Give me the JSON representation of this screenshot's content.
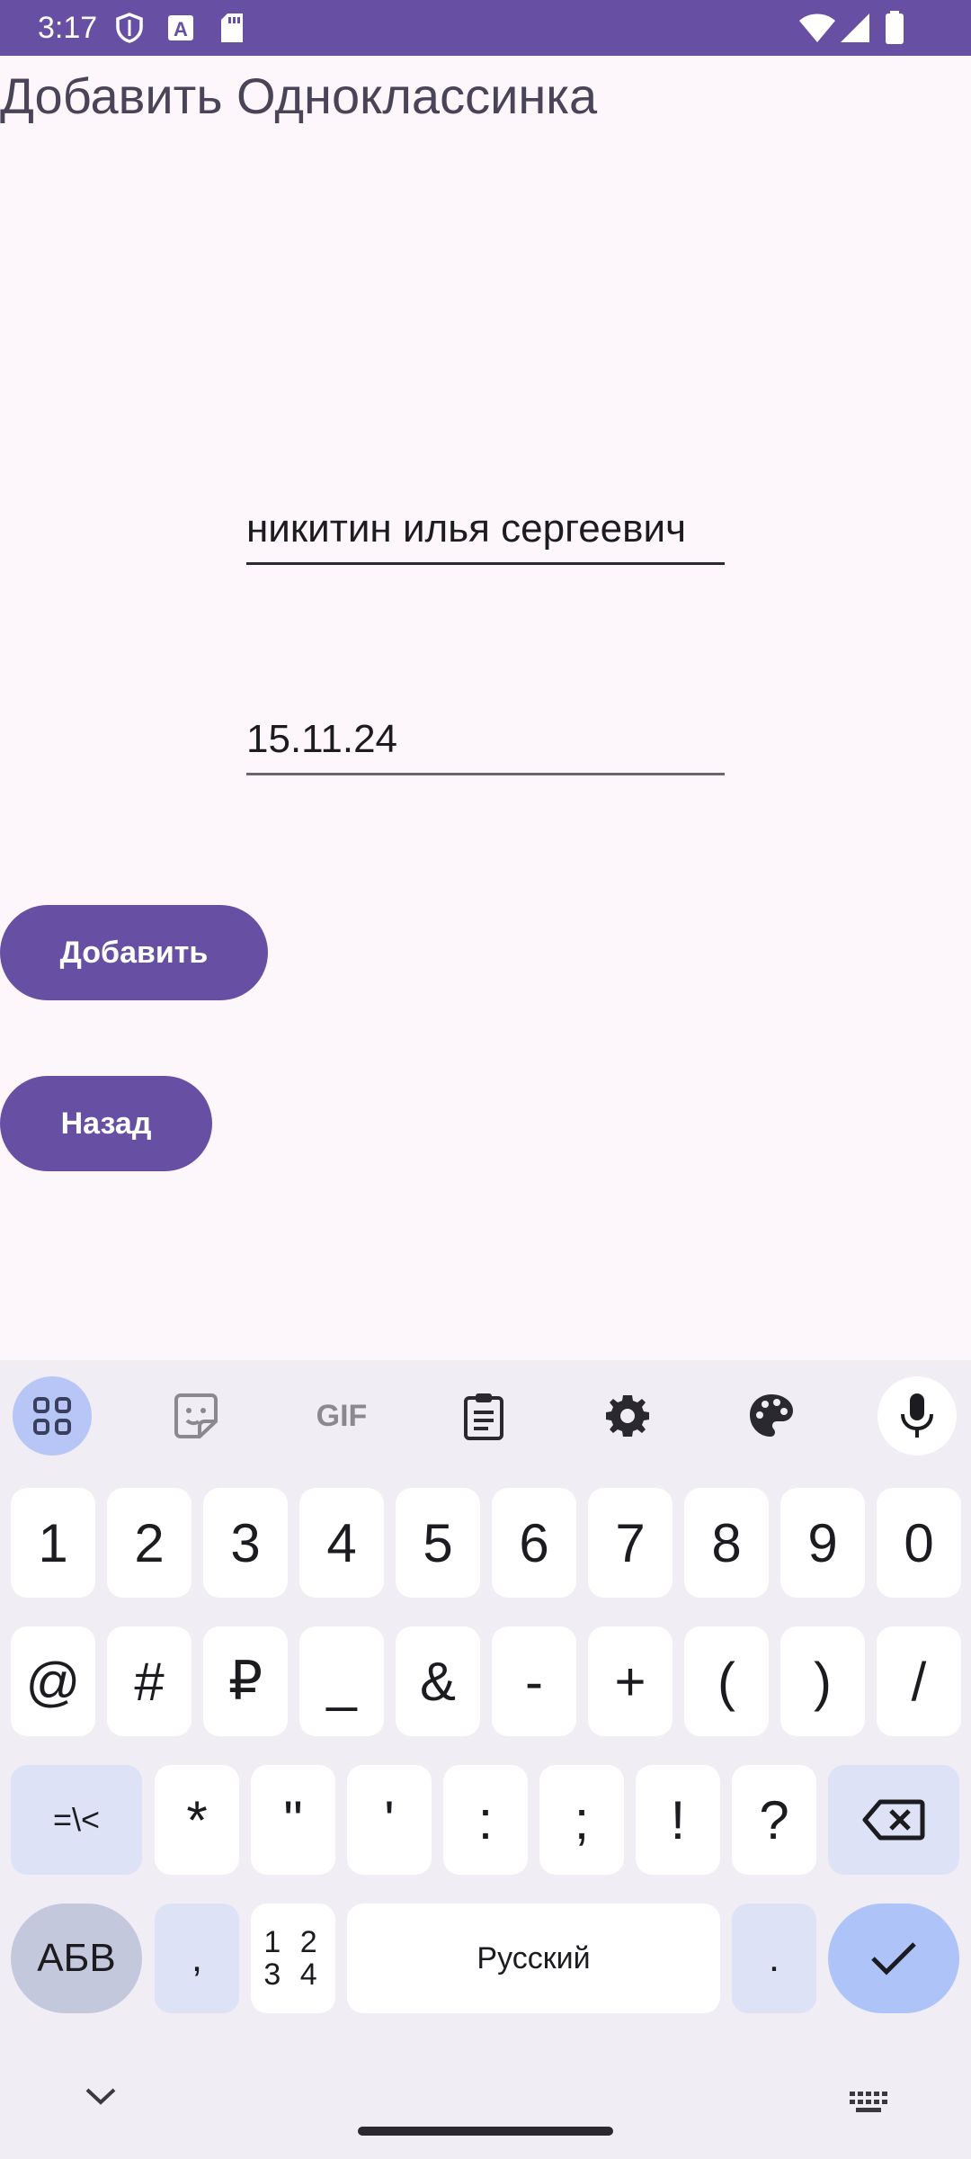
{
  "status_bar": {
    "time": "3:17",
    "icons": [
      "shield-icon",
      "app-a-icon",
      "sd-card-icon",
      "wifi-icon",
      "signal-icon",
      "battery-icon"
    ]
  },
  "screen": {
    "title": "Добавить Одноклассинка",
    "name_field": {
      "value": "никитин илья сергеевич"
    },
    "date_field": {
      "value": "15.11.24"
    },
    "add_button": "Добавить",
    "back_button": "Назад"
  },
  "keyboard": {
    "toolbar_icons": [
      "apps-grid-icon",
      "sticker-icon",
      "gif-icon",
      "clipboard-icon",
      "settings-gear-icon",
      "palette-icon",
      "microphone-icon"
    ],
    "gif_label": "GIF",
    "row1": [
      "1",
      "2",
      "3",
      "4",
      "5",
      "6",
      "7",
      "8",
      "9",
      "0"
    ],
    "row2": [
      "@",
      "#",
      "₽",
      "_",
      "&",
      "-",
      "+",
      "(",
      ")",
      "/"
    ],
    "row3": {
      "symbols_key": "=\\<",
      "keys": [
        "*",
        "\"",
        "'",
        ":",
        ";",
        "!",
        "?"
      ]
    },
    "row4": {
      "letters_key": "АБВ",
      "comma": ",",
      "numpad_key_top": "1 2",
      "numpad_key_bottom": "3 4",
      "space": "Русский",
      "period": "."
    }
  },
  "colors": {
    "primary": "#6750a4",
    "background": "#fdf7fc",
    "keyboard_bg": "#f0edf4",
    "enter_key": "#aec3f7"
  }
}
